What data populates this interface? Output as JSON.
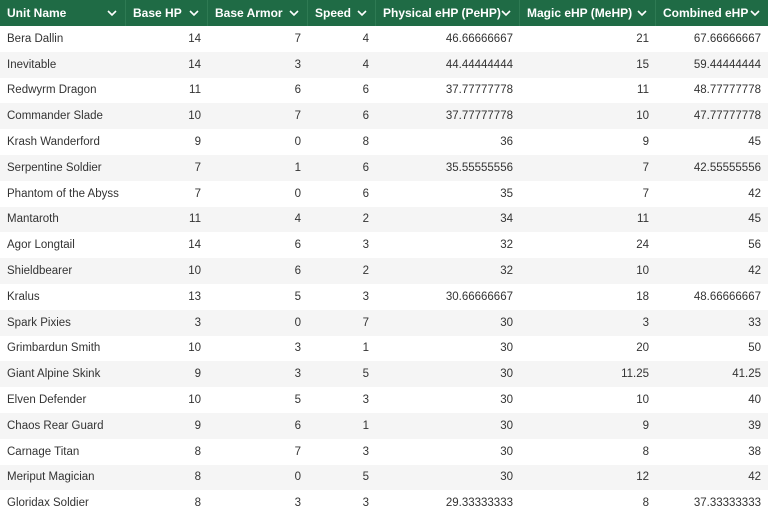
{
  "columns": [
    {
      "label": "Unit Name",
      "icon": "chevron-down-icon"
    },
    {
      "label": "Base HP",
      "icon": "chevron-down-icon"
    },
    {
      "label": "Base Armor",
      "icon": "chevron-down-icon"
    },
    {
      "label": "Speed",
      "icon": "chevron-down-icon"
    },
    {
      "label": "Physical eHP (PeHP)",
      "icon": "chevron-down-icon"
    },
    {
      "label": "Magic eHP (MeHP)",
      "icon": "chevron-down-icon"
    },
    {
      "label": "Combined eHP",
      "icon": "chevron-down-icon"
    }
  ],
  "rows": [
    [
      "Bera Dallin",
      "14",
      "7",
      "4",
      "46.66666667",
      "21",
      "67.66666667"
    ],
    [
      "Inevitable",
      "14",
      "3",
      "4",
      "44.44444444",
      "15",
      "59.44444444"
    ],
    [
      "Redwyrm Dragon",
      "11",
      "6",
      "6",
      "37.77777778",
      "11",
      "48.77777778"
    ],
    [
      "Commander Slade",
      "10",
      "7",
      "6",
      "37.77777778",
      "10",
      "47.77777778"
    ],
    [
      "Krash Wanderford",
      "9",
      "0",
      "8",
      "36",
      "9",
      "45"
    ],
    [
      "Serpentine Soldier",
      "7",
      "1",
      "6",
      "35.55555556",
      "7",
      "42.55555556"
    ],
    [
      "Phantom of the Abyss",
      "7",
      "0",
      "6",
      "35",
      "7",
      "42"
    ],
    [
      "Mantaroth",
      "11",
      "4",
      "2",
      "34",
      "11",
      "45"
    ],
    [
      "Agor Longtail",
      "14",
      "6",
      "3",
      "32",
      "24",
      "56"
    ],
    [
      "Shieldbearer",
      "10",
      "6",
      "2",
      "32",
      "10",
      "42"
    ],
    [
      "Kralus",
      "13",
      "5",
      "3",
      "30.66666667",
      "18",
      "48.66666667"
    ],
    [
      "Spark Pixies",
      "3",
      "0",
      "7",
      "30",
      "3",
      "33"
    ],
    [
      "Grimbardun Smith",
      "10",
      "3",
      "1",
      "30",
      "20",
      "50"
    ],
    [
      "Giant Alpine Skink",
      "9",
      "3",
      "5",
      "30",
      "11.25",
      "41.25"
    ],
    [
      "Elven Defender",
      "10",
      "5",
      "3",
      "30",
      "10",
      "40"
    ],
    [
      "Chaos Rear Guard",
      "9",
      "6",
      "1",
      "30",
      "9",
      "39"
    ],
    [
      "Carnage Titan",
      "8",
      "7",
      "3",
      "30",
      "8",
      "38"
    ],
    [
      "Meriput Magician",
      "8",
      "0",
      "5",
      "30",
      "12",
      "42"
    ],
    [
      "Gloridax Soldier",
      "8",
      "3",
      "3",
      "29.33333333",
      "8",
      "37.33333333"
    ]
  ],
  "colors": {
    "header_bg": "#1f6b45",
    "header_text": "#ffffff",
    "row_alt": "#f5f5f5",
    "text": "#333333"
  }
}
